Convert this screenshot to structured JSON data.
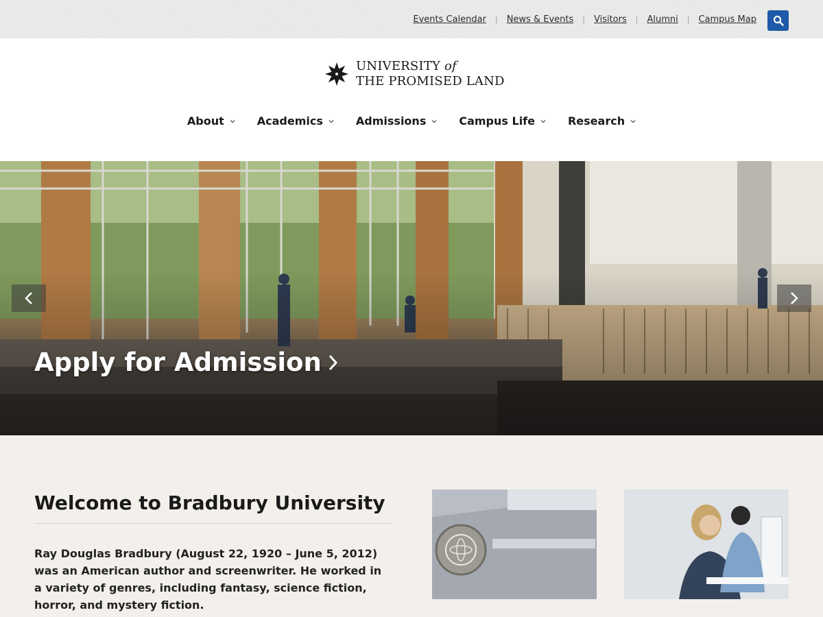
{
  "utility": {
    "links": [
      "Events Calendar",
      "News & Events",
      "Visitors",
      "Alumni",
      "Campus Map"
    ],
    "search_icon": "search-icon"
  },
  "brand": {
    "line1": "UNIVERSITY ",
    "line1_italic": "of",
    "line2": "THE PROMISED LAND"
  },
  "nav": {
    "items": [
      "About",
      "Academics",
      "Admissions",
      "Campus Life",
      "Research"
    ]
  },
  "hero": {
    "title": "Apply for Admission",
    "prev_icon": "chevron-left-icon",
    "next_icon": "chevron-right-icon"
  },
  "welcome": {
    "title": "Welcome to Bradbury University",
    "body": "Ray Douglas Bradbury (August 22, 1920 – June 5, 2012) was an American author and screenwriter. He worked in a variety of genres, including fantasy, science fiction, horror, and mystery fiction."
  },
  "colors": {
    "accent": "#1e5aa8",
    "utility_bg": "#ebebe9",
    "content_bg": "#f3f0ec"
  }
}
